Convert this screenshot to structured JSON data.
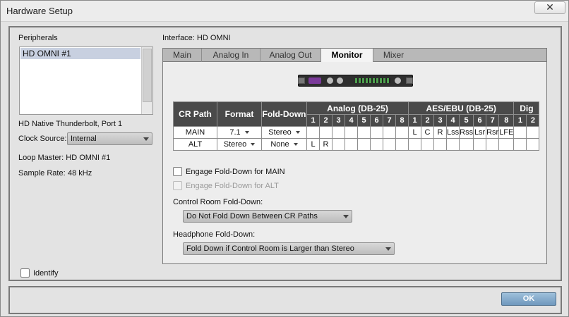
{
  "window": {
    "title": "Hardware Setup",
    "close_glyph": "✕"
  },
  "left": {
    "peripherals_label": "Peripherals",
    "peripherals": [
      "HD OMNI #1"
    ],
    "connection": "HD Native Thunderbolt, Port 1",
    "clock_source_label": "Clock Source:",
    "clock_source_value": "Internal",
    "loop_master": "Loop Master: HD OMNI #1",
    "sample_rate_label": "Sample Rate:",
    "sample_rate_value": "48 kHz",
    "identify_label": "Identify"
  },
  "interface_label": "Interface: HD OMNI",
  "tabs": [
    {
      "label": "Main",
      "active": false
    },
    {
      "label": "Analog In",
      "active": false
    },
    {
      "label": "Analog Out",
      "active": false
    },
    {
      "label": "Monitor",
      "active": true
    },
    {
      "label": "Mixer",
      "active": false
    }
  ],
  "routing": {
    "headers": {
      "cr_path": "CR Path",
      "format": "Format",
      "fold_down": "Fold-Down",
      "analog": "Analog (DB-25)",
      "aes": "AES/EBU (DB-25)",
      "dig": "Dig"
    },
    "analog_nums": [
      "1",
      "2",
      "3",
      "4",
      "5",
      "6",
      "7",
      "8"
    ],
    "aes_nums": [
      "1",
      "2",
      "3",
      "4",
      "5",
      "6",
      "7",
      "8"
    ],
    "dig_nums": [
      "1",
      "2"
    ],
    "rows": [
      {
        "path": "MAIN",
        "format": "7.1",
        "fold": "Stereo",
        "analog": [
          "",
          "",
          "",
          "",
          "",
          "",
          "",
          ""
        ],
        "aes": [
          "L",
          "C",
          "R",
          "Lss",
          "Rss",
          "Lsr",
          "Rsr",
          "LFE"
        ],
        "dig": [
          "",
          ""
        ]
      },
      {
        "path": "ALT",
        "format": "Stereo",
        "fold": "None",
        "analog": [
          "L",
          "R",
          "",
          "",
          "",
          "",
          "",
          ""
        ],
        "aes": [
          "",
          "",
          "",
          "",
          "",
          "",
          "",
          ""
        ],
        "dig": [
          "",
          ""
        ]
      }
    ]
  },
  "options": {
    "engage_main": "Engage Fold-Down for MAIN",
    "engage_alt": "Engage Fold-Down for ALT",
    "cr_fold_label": "Control Room Fold-Down:",
    "cr_fold_value": "Do Not Fold Down Between CR Paths",
    "hp_fold_label": "Headphone Fold-Down:",
    "hp_fold_value": "Fold Down if Control Room is Larger than Stereo"
  },
  "footer": {
    "ok_label": "OK"
  },
  "colors": {
    "table_header": "#4a4a4a",
    "ok_button": "#7ea6c7",
    "selected_item": "#c8d0e0"
  }
}
